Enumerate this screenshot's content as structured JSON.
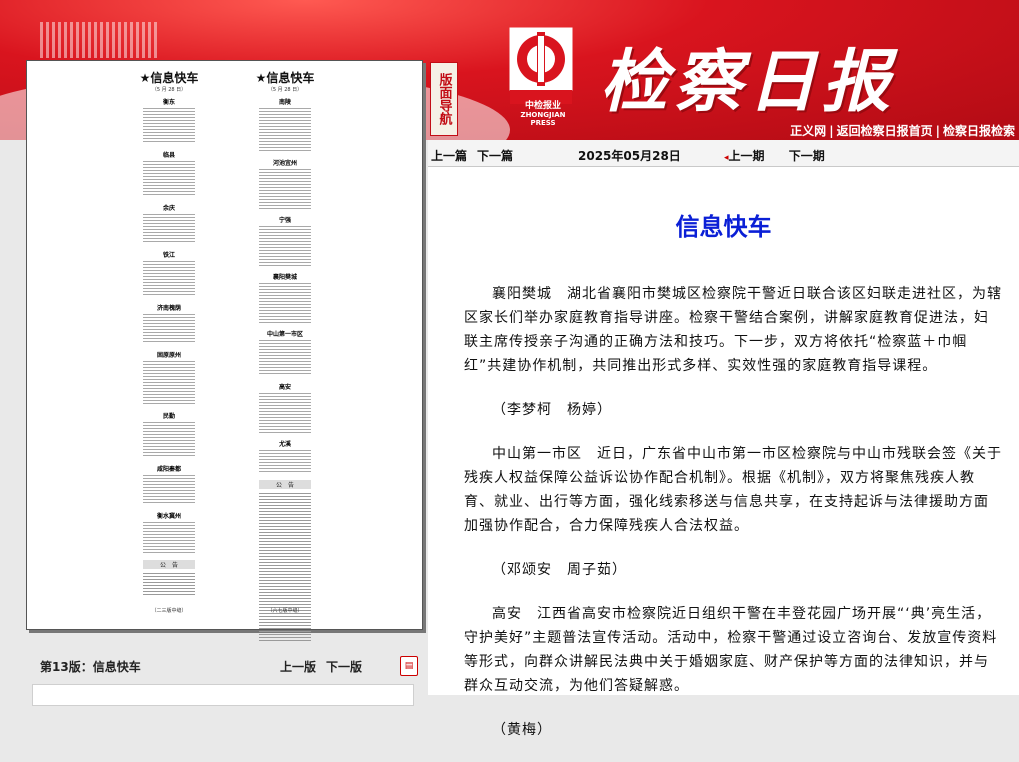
{
  "header": {
    "logo_caption": "中检报业",
    "logo_en": "ZHONGJIAN PRESS",
    "title": "检察日报",
    "nav_badge": "版面导航",
    "links": [
      "正义网",
      "返回检察日报首页",
      "检察日报检索"
    ]
  },
  "toolbar": {
    "prev_article": "上一篇",
    "next_article": "下一篇",
    "date": "2025年05月28日",
    "prev_issue": "上一期",
    "next_issue": "下一期"
  },
  "paper": {
    "col1": {
      "heading": "★信息快车",
      "date": "（5 月 28 日）",
      "items": [
        "衡东",
        "临县",
        "余庆",
        "铁江",
        "济南槐荫",
        "固原原州",
        "民勤",
        "咸阳秦都",
        "衡水冀州"
      ],
      "notice": "公　告",
      "footer": "（二三版中缝）"
    },
    "col2": {
      "heading": "★信息快车",
      "date": "（5 月 28 日）",
      "items": [
        "南陵",
        "河池宜州",
        "宁强",
        "襄阳樊城",
        "中山第一市区",
        "高安",
        "尤溪"
      ],
      "notice": "公　告",
      "footer": "（六七版中缝）"
    }
  },
  "footer": {
    "section": "第13版：信息快车",
    "prev_page": "上一版",
    "next_page": "下一版",
    "pdf_icon": "pdf-icon"
  },
  "article": {
    "title": "信息快车",
    "paragraphs": [
      "襄阳樊城　湖北省襄阳市樊城区检察院干警近日联合该区妇联走进社区，为辖区家长们举办家庭教育指导讲座。检察干警结合案例，讲解家庭教育促进法，妇联主席传授亲子沟通的正确方法和技巧。下一步，双方将依托“检察蓝＋巾帼红”共建协作机制，共同推出形式多样、实效性强的家庭教育指导课程。",
      "（李梦柯　杨婷）",
      "中山第一市区　近日，广东省中山市第一市区检察院与中山市残联会签《关于残疾人权益保障公益诉讼协作配合机制》。根据《机制》，双方将聚焦残疾人教育、就业、出行等方面，强化线索移送与信息共享，在支持起诉与法律援助方面加强协作配合，合力保障残疾人合法权益。",
      "（邓颂安　周子茹）",
      "高安　江西省高安市检察院近日组织干警在丰登花园广场开展“‘典’亮生活，守护美好”主题普法宣传活动。活动中，检察干警通过设立咨询台、发放宣传资料等形式，向群众讲解民法典中关于婚姻家庭、财产保护等方面的法律知识，并与群众互动交流，为他们答疑解惑。",
      "（黄梅）"
    ]
  }
}
